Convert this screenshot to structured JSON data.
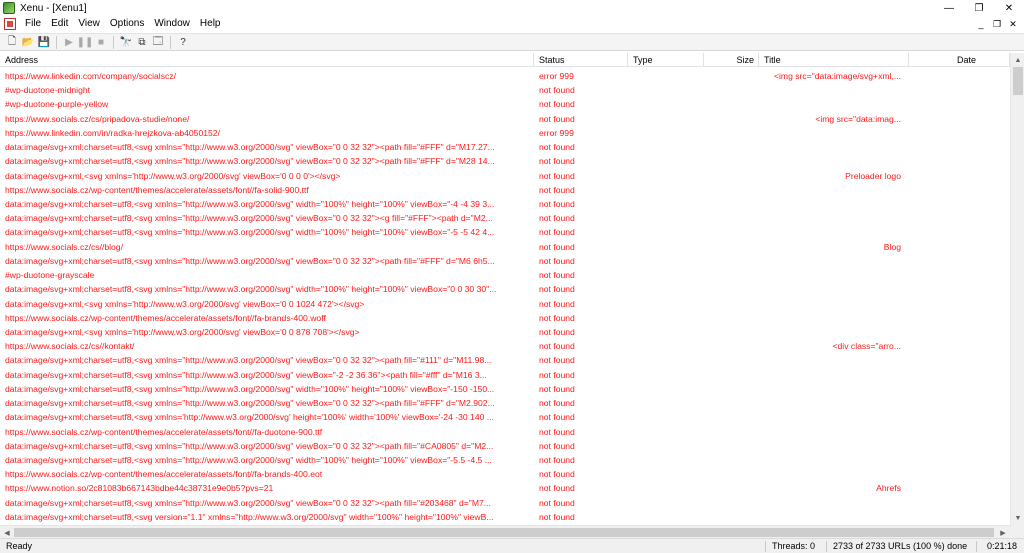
{
  "window": {
    "title": "Xenu - [Xenu1]",
    "controls": {
      "minimize": "—",
      "maximize": "❐",
      "close": "✕"
    }
  },
  "menu": [
    "File",
    "Edit",
    "View",
    "Options",
    "Window",
    "Help"
  ],
  "mdi_controls": {
    "minimize": "_",
    "restore": "❐",
    "close": "✕"
  },
  "toolbar": {
    "buttons": [
      {
        "name": "new-file-icon",
        "glyph": "🗋",
        "enabled": true
      },
      {
        "name": "open-folder-icon",
        "glyph": "📂",
        "enabled": true
      },
      {
        "name": "save-icon",
        "glyph": "💾",
        "enabled": true
      },
      {
        "name": "play-icon",
        "glyph": "▶",
        "enabled": false
      },
      {
        "name": "pause-icon",
        "glyph": "❚❚",
        "enabled": false
      },
      {
        "name": "stop-icon",
        "glyph": "■",
        "enabled": false
      },
      {
        "name": "find-binoculars-icon",
        "glyph": "🔭",
        "enabled": true
      },
      {
        "name": "copy-icon",
        "glyph": "⧉",
        "enabled": true
      },
      {
        "name": "properties-icon",
        "glyph": "🗔",
        "enabled": true
      },
      {
        "name": "help-icon",
        "glyph": "?",
        "enabled": true
      }
    ]
  },
  "columns": [
    "Address",
    "Status",
    "Type",
    "Size",
    "Title",
    "Date"
  ],
  "rows": [
    {
      "address": "https://www.linkedin.com/company/socialscz/",
      "status": "error 999",
      "title": "<img src=\"data:image/svg+xml,..."
    },
    {
      "address": "#wp-duotone-midnight",
      "status": "not found",
      "title": ""
    },
    {
      "address": "#wp-duotone-purple-yellow",
      "status": "not found",
      "title": ""
    },
    {
      "address": "https://www.socials.cz/cs/pripadova-studie/none/",
      "status": "not found",
      "title": "<img src=\"data:imag..."
    },
    {
      "address": "https://www.linkedin.com/in/radka-hrejzkova-ab4050152/",
      "status": "error 999",
      "title": ""
    },
    {
      "address": "data:image/svg+xml;charset=utf8,<svg xmlns=\"http://www.w3.org/2000/svg\" viewBox=\"0 0 32 32\"><path fill=\"#FFF\" d=\"M17.27...",
      "status": "not found",
      "title": ""
    },
    {
      "address": "data:image/svg+xml;charset=utf8,<svg xmlns=\"http://www.w3.org/2000/svg\" viewBox=\"0 0 32 32\"><path fill=\"#FFF\" d=\"M28 14...",
      "status": "not found",
      "title": ""
    },
    {
      "address": "data:image/svg+xml,<svg xmlns='http://www.w3.org/2000/svg' viewBox='0 0 0 0'></svg>",
      "status": "not found",
      "title": "Preloader logo"
    },
    {
      "address": "https://www.socials.cz/wp-content/themes/accelerate/assets/font//fa-solid-900.ttf",
      "status": "not found",
      "title": ""
    },
    {
      "address": "data:image/svg+xml;charset=utf8,<svg xmlns=\"http://www.w3.org/2000/svg\" width=\"100%\" height=\"100%\" viewBox=\"-4 -4 39 3...",
      "status": "not found",
      "title": ""
    },
    {
      "address": "data:image/svg+xml;charset=utf8,<svg xmlns=\"http://www.w3.org/2000/svg\" viewBox=\"0 0 32 32\"><g fill=\"#FFF\"><path d=\"M2...",
      "status": "not found",
      "title": ""
    },
    {
      "address": "data:image/svg+xml;charset=utf8,<svg xmlns=\"http://www.w3.org/2000/svg\" width=\"100%\" height=\"100%\" viewBox=\"-5 -5 42 4...",
      "status": "not found",
      "title": ""
    },
    {
      "address": "https://www.socials.cz/cs//blog/",
      "status": "not found",
      "title": "Blog"
    },
    {
      "address": "data:image/svg+xml;charset=utf8,<svg xmlns=\"http://www.w3.org/2000/svg\" viewBox=\"0 0 32 32\"><path fill=\"#FFF\" d=\"M6 6h5...",
      "status": "not found",
      "title": ""
    },
    {
      "address": "#wp-duotone-grayscale",
      "status": "not found",
      "title": ""
    },
    {
      "address": "data:image/svg+xml;charset=utf8,<svg xmlns=\"http://www.w3.org/2000/svg\" width=\"100%\" height=\"100%\" viewBox=\"0 0 30 30\"...",
      "status": "not found",
      "title": ""
    },
    {
      "address": "data:image/svg+xml,<svg xmlns='http://www.w3.org/2000/svg' viewBox='0 0 1024 472'></svg>",
      "status": "not found",
      "title": ""
    },
    {
      "address": "https://www.socials.cz/wp-content/themes/accelerate/assets/font//fa-brands-400.woff",
      "status": "not found",
      "title": ""
    },
    {
      "address": "data:image/svg+xml,<svg xmlns='http://www.w3.org/2000/svg' viewBox='0 0 878 708'></svg>",
      "status": "not found",
      "title": ""
    },
    {
      "address": "https://www.socials.cz/cs//kontakt/",
      "status": "not found",
      "title": "<div class=\"arro..."
    },
    {
      "address": "data:image/svg+xml;charset=utf8,<svg xmlns=\"http://www.w3.org/2000/svg\" viewBox=\"0 0 32 32\"><path fill=\"#111\" d=\"M11.98...",
      "status": "not found",
      "title": ""
    },
    {
      "address": "data:image/svg+xml;charset=utf8,<svg xmlns=\"http://www.w3.org/2000/svg\" viewBox=\"-2 -2 36 36\"><path fill=\"#fff\" d=\"M16 3...",
      "status": "not found",
      "title": ""
    },
    {
      "address": "data:image/svg+xml;charset=utf8,<svg xmlns=\"http://www.w3.org/2000/svg\" width=\"100%\" height=\"100%\" viewBox=\"-150 -150...",
      "status": "not found",
      "title": ""
    },
    {
      "address": "data:image/svg+xml;charset=utf8,<svg xmlns=\"http://www.w3.org/2000/svg\" viewBox=\"0 0 32 32\"><path fill=\"#FFF\" d=\"M2.902...",
      "status": "not found",
      "title": ""
    },
    {
      "address": "data:image/svg+xml;charset=utf8,<svg xmlns='http://www.w3.org/2000/svg' height='100%' width='100%' viewBox='-24 -30 140 ...",
      "status": "not found",
      "title": ""
    },
    {
      "address": "https://www.socials.cz/wp-content/themes/accelerate/assets/font//fa-duotone-900.ttf",
      "status": "not found",
      "title": ""
    },
    {
      "address": "data:image/svg+xml;charset=utf8,<svg xmlns=\"http://www.w3.org/2000/svg\" viewBox=\"0 0 32 32\"><path fill=\"#CA0805\" d=\"M2...",
      "status": "not found",
      "title": ""
    },
    {
      "address": "data:image/svg+xml;charset=utf8,<svg xmlns=\"http://www.w3.org/2000/svg\" width=\"100%\" height=\"100%\" viewBox=\"-5.5 -4.5 ...",
      "status": "not found",
      "title": ""
    },
    {
      "address": "https://www.socials.cz/wp-content/themes/accelerate/assets/font//fa-brands-400.eot",
      "status": "not found",
      "title": ""
    },
    {
      "address": "https://www.notion.so/2c81083b667143bdbe44c38731e9e0b5?pvs=21",
      "status": "not found",
      "title": "Ahrefs"
    },
    {
      "address": "data:image/svg+xml;charset=utf8,<svg xmlns=\"http://www.w3.org/2000/svg\" viewBox=\"0 0 32 32\"><path fill=\"#203468\" d=\"M7...",
      "status": "not found",
      "title": ""
    },
    {
      "address": "data:image/svg+xml;charset=utf8,<svg version=\"1.1\" xmlns=\"http://www.w3.org/2000/svg\" width=\"100%\" height=\"100%\" viewB...",
      "status": "not found",
      "title": ""
    }
  ],
  "status_bar": {
    "state": "Ready",
    "threads": "Threads: 0",
    "progress": "2733 of 2733 URLs (100 %) done",
    "elapsed": "0:21:18"
  },
  "colors": {
    "error_text": "#ff1a1a",
    "chrome": "#f0f0f0"
  }
}
